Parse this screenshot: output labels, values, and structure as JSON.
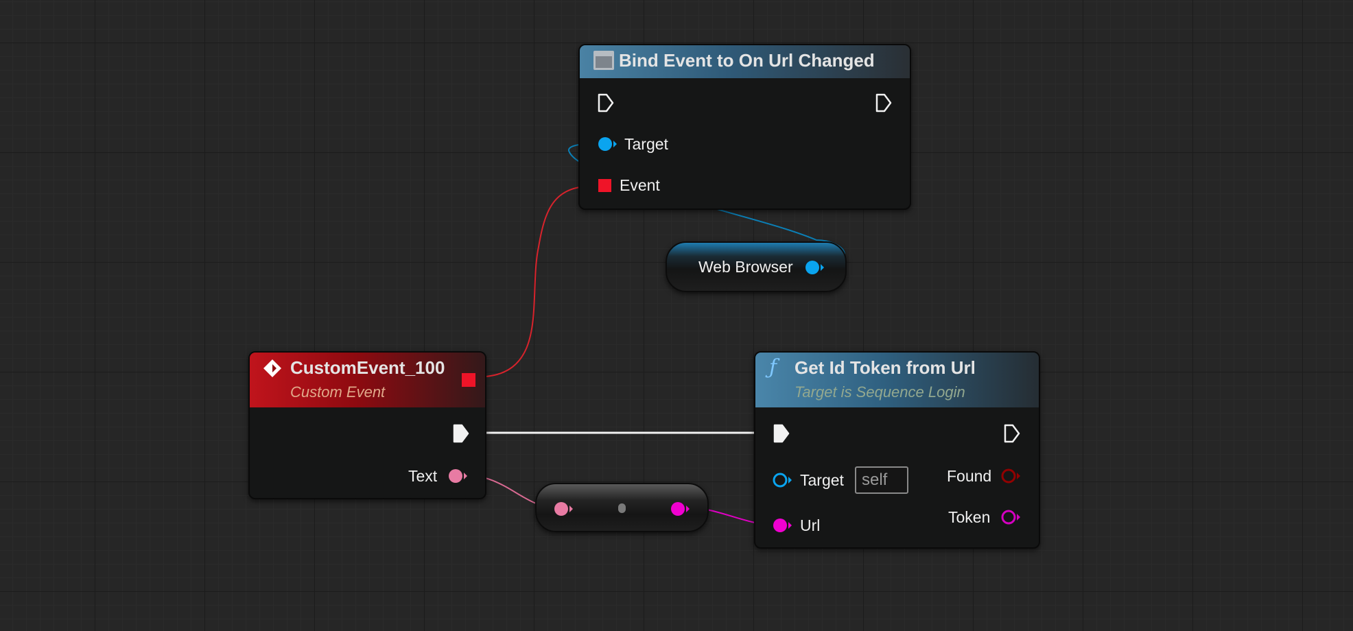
{
  "graph": {
    "bind_node": {
      "title": "Bind Event to On Url Changed",
      "pins": {
        "target": "Target",
        "event": "Event"
      }
    },
    "web_browser_node": {
      "label": "Web Browser"
    },
    "custom_event_node": {
      "title": "CustomEvent_100",
      "subtitle": "Custom Event",
      "pins": {
        "text": "Text"
      }
    },
    "get_token_node": {
      "title": "Get Id Token from Url",
      "subtitle": "Target is Sequence Login",
      "pins": {
        "target": "Target",
        "target_default": "self",
        "url": "Url",
        "found": "Found",
        "token": "Token"
      }
    }
  },
  "colors": {
    "exec": "#ffffff",
    "object": "#0aa4ef",
    "delegate": "#ef1428",
    "text": "#e87ba3",
    "string": "#f000d0",
    "boolean": "#920101",
    "token_output": "#d400c0"
  }
}
